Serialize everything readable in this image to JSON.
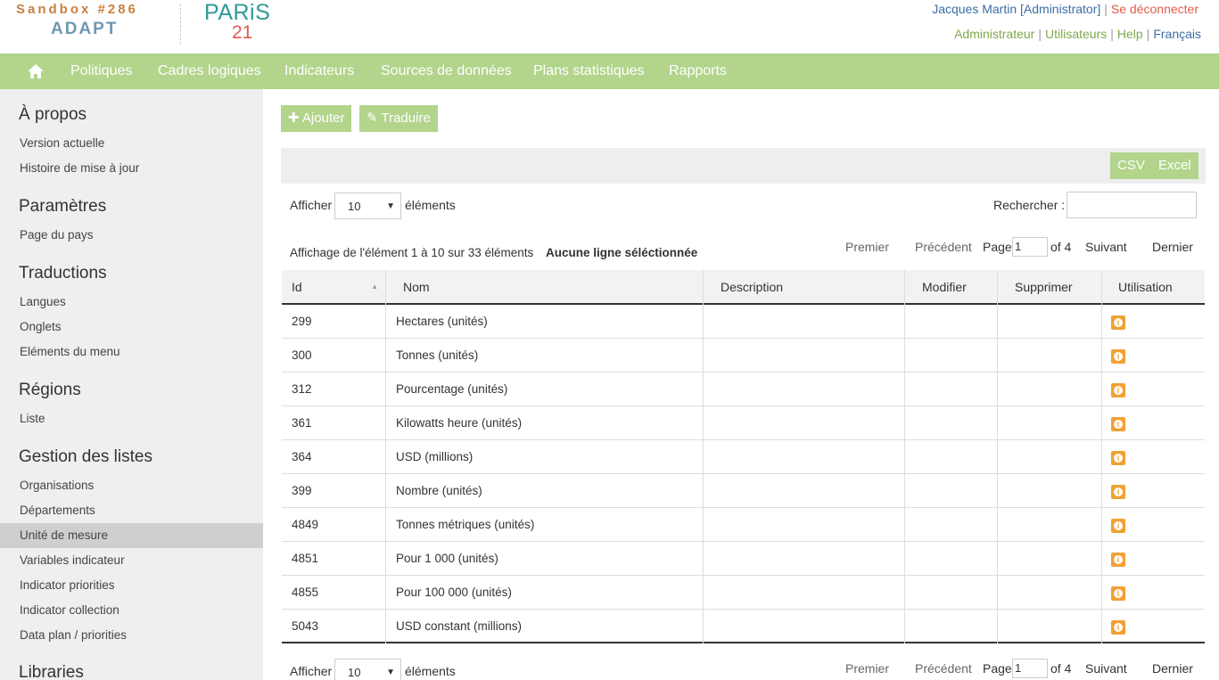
{
  "header": {
    "logo_top": "Sandbox #286",
    "logo_bottom": "ADAPT",
    "partner_logo_main": "PARiS",
    "partner_logo_sub": "21",
    "user": "Jacques Martin [Administrator]",
    "logout": "Se déconnecter",
    "links": [
      "Administrateur",
      "Utilisateurs",
      "Help"
    ],
    "language": "Français"
  },
  "nav": {
    "items": [
      "Politiques",
      "Cadres logiques",
      "Indicateurs",
      "Sources de données",
      "Plans statistiques",
      "Rapports"
    ]
  },
  "sidebar": {
    "sections": [
      {
        "title": "À propos",
        "items": [
          "Version actuelle",
          "Histoire de mise à jour"
        ]
      },
      {
        "title": "Paramètres",
        "items": [
          "Page du pays"
        ]
      },
      {
        "title": "Traductions",
        "items": [
          "Langues",
          "Onglets",
          "Eléments du menu"
        ]
      },
      {
        "title": "Régions",
        "items": [
          "Liste"
        ]
      },
      {
        "title": "Gestion des listes",
        "items": [
          "Organisations",
          "Départements",
          "Unité de mesure",
          "Variables indicateur",
          "Indicator priorities",
          "Indicator collection",
          "Data plan / priorities"
        ]
      },
      {
        "title": "Libraries",
        "items": []
      }
    ],
    "active_item": "Unité de mesure"
  },
  "actions": {
    "add": "Ajouter",
    "translate": "Traduire"
  },
  "export": {
    "csv": "CSV",
    "excel": "Excel"
  },
  "controls": {
    "show_label": "Afficher",
    "page_size": "10",
    "elements_label": "éléments",
    "search_label": "Rechercher :",
    "info": "Affichage de l'élément 1 à 10 sur 33 éléments",
    "selection": "Aucune ligne séléctionnée"
  },
  "pager": {
    "first": "Premier",
    "prev": "Précédent",
    "page_label": "Page",
    "page": "1",
    "of": "of 4",
    "next": "Suivant",
    "last": "Dernier"
  },
  "table": {
    "columns": [
      "Id",
      "Nom",
      "Description",
      "Modifier",
      "Supprimer",
      "Utilisation"
    ],
    "rows": [
      {
        "id": "299",
        "nom": "Hectares (unités)"
      },
      {
        "id": "300",
        "nom": "Tonnes (unités)"
      },
      {
        "id": "312",
        "nom": "Pourcentage (unités)"
      },
      {
        "id": "361",
        "nom": "Kilowatts heure (unités)"
      },
      {
        "id": "364",
        "nom": "USD (millions)"
      },
      {
        "id": "399",
        "nom": "Nombre (unités)"
      },
      {
        "id": "4849",
        "nom": "Tonnes métriques (unités)"
      },
      {
        "id": "4851",
        "nom": "Pour 1 000 (unités)"
      },
      {
        "id": "4855",
        "nom": "Pour 100 000 (unités)"
      },
      {
        "id": "5043",
        "nom": "USD constant (millions)"
      }
    ]
  },
  "colors": {
    "accent_green": "#b2d48b",
    "info_orange": "#f0a132",
    "link_blue": "#3b6ea5",
    "logout_red": "#e35b4a"
  }
}
